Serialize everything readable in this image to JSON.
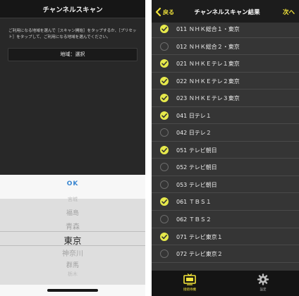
{
  "left_screen": {
    "title": "チャンネルスキャン",
    "description": "ご利用になる地域を選んで［スキャン開始］をタップするか、［プリセット］をタップして、ご利用になる地域を選んでください。",
    "region_button": "地域：選択",
    "ok": "OK",
    "picker_items": [
      "福島",
      "青森",
      "東京",
      "神奈川",
      "群馬"
    ],
    "selected": "東京"
  },
  "right_screen": {
    "back": "戻る",
    "title": "チャンネルスキャン結果",
    "next": "次へ",
    "channels": [
      {
        "label": "011 ＮＨＫ総合１・東京",
        "checked": true
      },
      {
        "label": "012 ＮＨＫ総合２・東京",
        "checked": false
      },
      {
        "label": "021 ＮＨＫＥテレ１東京",
        "checked": true
      },
      {
        "label": "022 ＮＨＫＥテレ２東京",
        "checked": true
      },
      {
        "label": "023 ＮＨＫＥテレ３東京",
        "checked": true
      },
      {
        "label": "041 日テレ１",
        "checked": true
      },
      {
        "label": "042 日テレ２",
        "checked": false
      },
      {
        "label": "051 テレビ朝日",
        "checked": true
      },
      {
        "label": "052 テレビ朝日",
        "checked": false
      },
      {
        "label": "053 テレビ朝日",
        "checked": false
      },
      {
        "label": "061 ＴＢＳ１",
        "checked": true
      },
      {
        "label": "062 ＴＢＳ２",
        "checked": false
      },
      {
        "label": "071 テレビ東京１",
        "checked": true
      },
      {
        "label": "072 テレビ東京２",
        "checked": false
      }
    ],
    "tabs": [
      {
        "label": "接続待機",
        "icon": "tv-icon",
        "active": true
      },
      {
        "label": "設定",
        "icon": "gear-icon",
        "active": false
      }
    ]
  },
  "colors": {
    "accent_yellow": "#f2e43a",
    "check_on": "#e6e94b",
    "ok_blue": "#3a86d0"
  }
}
